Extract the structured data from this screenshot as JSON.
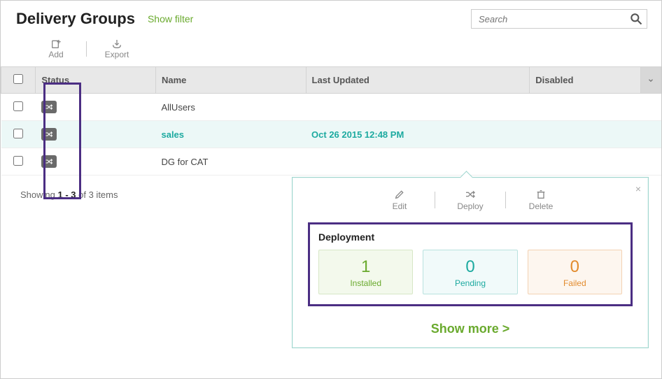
{
  "pageTitle": "Delivery Groups",
  "showFilter": "Show filter",
  "search": {
    "placeholder": "Search"
  },
  "actions": {
    "add": "Add",
    "export": "Export"
  },
  "columns": {
    "status": "Status",
    "name": "Name",
    "last": "Last Updated",
    "disabled": "Disabled"
  },
  "rows": [
    {
      "name": "AllUsers",
      "last": ""
    },
    {
      "name": "sales",
      "last": "Oct 26 2015 12:48 PM"
    },
    {
      "name": "DG for CAT",
      "last": ""
    }
  ],
  "pagingPrefix": "Showing ",
  "pagingRange": "1 - 3",
  "pagingMiddle": " of ",
  "pagingTotal": "3",
  "pagingSuffix": " items",
  "pop": {
    "edit": "Edit",
    "deploy": "Deploy",
    "delete": "Delete",
    "deployTitle": "Deployment",
    "installedNum": "1",
    "installedLbl": "Installed",
    "pendingNum": "0",
    "pendingLbl": "Pending",
    "failedNum": "0",
    "failedLbl": "Failed",
    "showMore": "Show more >"
  }
}
